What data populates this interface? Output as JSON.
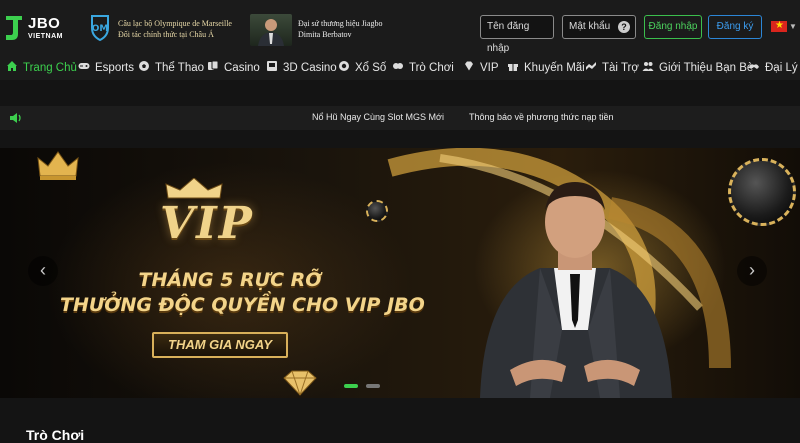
{
  "header": {
    "brand": "JBO",
    "country": "VIETNAM",
    "partner1": {
      "line1": "Câu lạc bộ Olympique de Marseille",
      "line2": "Đối tác chính thức tại Châu Á"
    },
    "partner2": {
      "line1": "Đại sứ thương hiệu Jiagbo",
      "line2": "Dimita Berbatov"
    },
    "username_placeholder": "Tên đăng nhập",
    "password_placeholder": "Mật khẩu",
    "help_symbol": "?",
    "login_label": "Đăng nhập",
    "register_label": "Đăng ký",
    "language_flag": "vietnam-flag-icon",
    "colors": {
      "accent_green": "#3ccf4e",
      "accent_blue": "#2c86d6"
    }
  },
  "nav": {
    "items": [
      {
        "label": "Trang Chủ",
        "icon": "home-icon",
        "active": true
      },
      {
        "label": "Esports",
        "icon": "gamepad-icon"
      },
      {
        "label": "Thể Thao",
        "icon": "soccer-ball-icon"
      },
      {
        "label": "Casino",
        "icon": "casino-cards-icon"
      },
      {
        "label": "3D Casino",
        "icon": "slot-machine-icon"
      },
      {
        "label": "Xổ Số",
        "icon": "lottery-ball-icon"
      },
      {
        "label": "Trò Chơi",
        "icon": "game-icon"
      },
      {
        "label": "VIP",
        "icon": "diamond-icon"
      },
      {
        "label": "Khuyến Mãi",
        "icon": "gift-icon"
      },
      {
        "label": "Tài Trợ",
        "icon": "sponsor-icon"
      },
      {
        "label": "Giới Thiệu Bạn Bè",
        "icon": "friends-icon"
      },
      {
        "label": "Đại Lý",
        "icon": "agent-icon"
      }
    ]
  },
  "notice": {
    "messages": [
      "Nổ Hũ Ngay Cùng Slot MGS Mới",
      "Thông báo về phương thức nạp tiền"
    ]
  },
  "banner": {
    "vip_text": "VIP",
    "headline1": "THÁNG 5 RỰC RỠ",
    "headline2": "THƯỞNG ĐỘC QUYỀN CHO VIP JBO",
    "cta_label": "THAM GIA NGAY",
    "prev_symbol": "‹",
    "next_symbol": "›",
    "slides_count": 2,
    "active_slide": 1
  },
  "section": {
    "title": "Trò Chơi"
  }
}
